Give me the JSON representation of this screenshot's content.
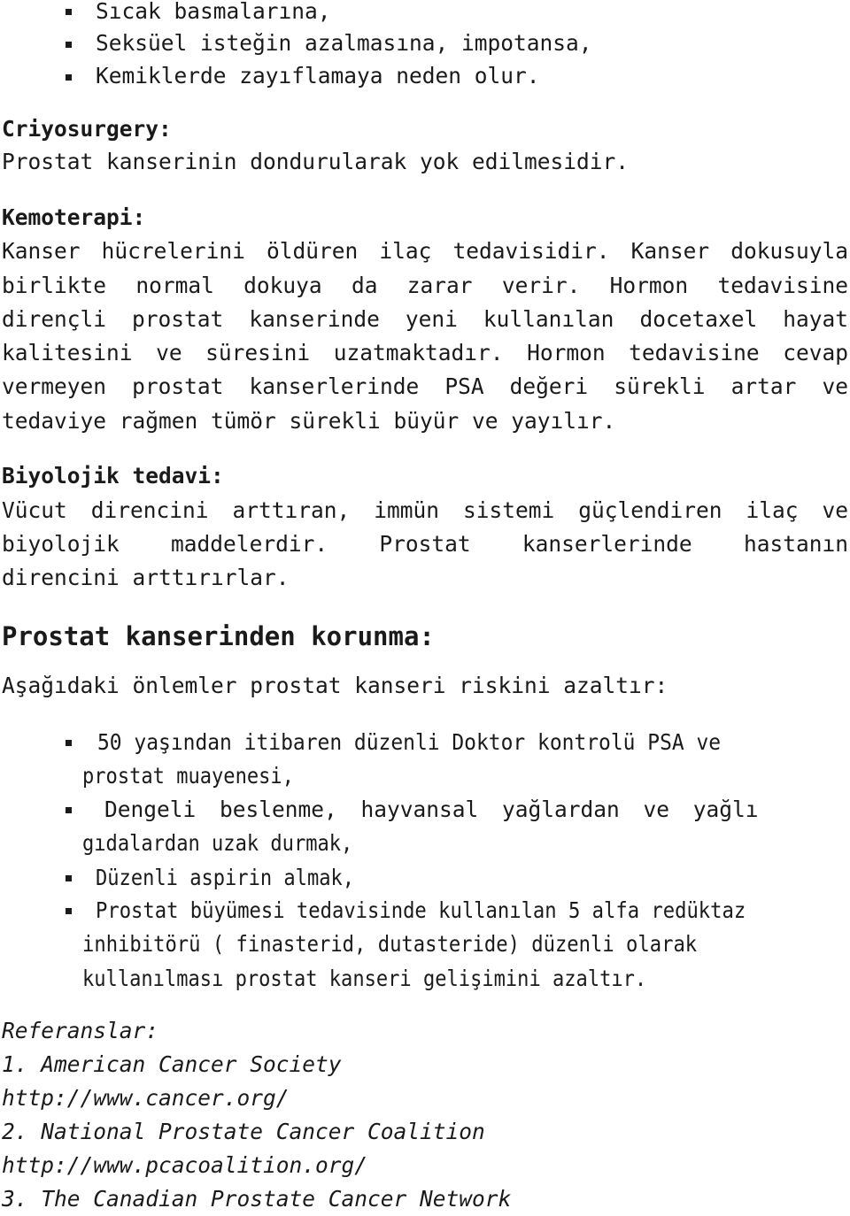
{
  "top_list": [
    "Sıcak basmalarına,",
    "Seksüel isteğin azalmasına, impotansa,",
    "Kemiklerde zayıflamaya neden olur."
  ],
  "sections": {
    "criyo": {
      "heading": "Criyosurgery:",
      "lines": [
        "Prostat kanserinin dondurularak yok edilmesidir."
      ]
    },
    "kemo": {
      "heading": "Kemoterapi:",
      "lines": [
        "Kanser hücrelerini öldüren ilaç tedavisidir. Kanser dokusuyla",
        "birlikte normal dokuya da zarar verir. Hormon tedavisine",
        "dirençli prostat kanserinde yeni kullanılan docetaxel hayat",
        "kalitesini ve süresini uzatmaktadır. Hormon tedavisine cevap",
        "vermeyen prostat kanserlerinde PSA değeri sürekli artar ve",
        "tedaviye rağmen tümör sürekli büyür ve yayılır."
      ]
    },
    "bio": {
      "heading": "Biyolojik tedavi:",
      "lines": [
        "Vücut direncini arttıran, immün sistemi güçlendiren ilaç ve",
        "biyolojik maddelerdir. Prostat kanserlerinde hastanın",
        "direncini arttırırlar."
      ]
    }
  },
  "prevention": {
    "heading": "Prostat kanserinden korunma:",
    "intro": "Aşağıdaki önlemler prostat kanseri riskini azaltır:",
    "items": [
      {
        "first": "50 yaşından itibaren düzenli Doktor kontrolü PSA ve",
        "rest": [
          "prostat muayenesi,"
        ]
      },
      {
        "first": "Dengeli beslenme, hayvansal yağlardan ve yağlı",
        "rest": [
          "gıdalardan uzak durmak,"
        ]
      },
      {
        "first": "Düzenli aspirin almak,",
        "rest": []
      },
      {
        "first": "Prostat büyümesi tedavisinde kullanılan 5 alfa redüktaz",
        "rest": [
          "inhibitörü ( finasterid, dutasteride) düzenli olarak",
          "kullanılması prostat kanseri gelişimini azaltır."
        ]
      }
    ]
  },
  "references": {
    "heading": "Referanslar:",
    "lines": [
      "1. American Cancer Society",
      "http://www.cancer.org/",
      "2. National Prostate Cancer Coalition",
      "http://www.pcacoalition.org/",
      "3. The Canadian Prostate Cancer Network"
    ]
  }
}
